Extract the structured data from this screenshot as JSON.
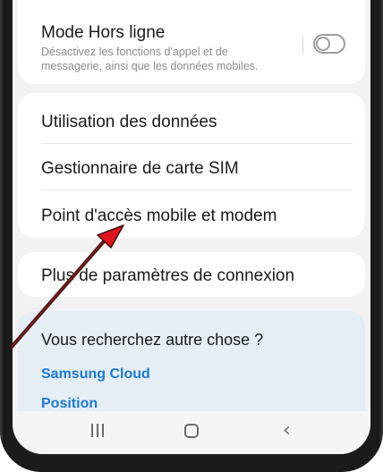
{
  "offline_mode": {
    "title": "Mode Hors ligne",
    "description": "Désactivez les fonctions d'appel et de messagerie, ainsi que les données mobiles.",
    "enabled": false
  },
  "connections": {
    "items": [
      {
        "label": "Utilisation des données"
      },
      {
        "label": "Gestionnaire de carte SIM"
      },
      {
        "label": "Point d'accès mobile et modem"
      }
    ]
  },
  "more_settings": {
    "label": "Plus de paramètres de connexion"
  },
  "suggestions": {
    "title": "Vous recherchez autre chose ?",
    "links": [
      "Samsung Cloud",
      "Position"
    ]
  },
  "navbar": {
    "icons": [
      "recent-apps-icon",
      "home-icon",
      "back-icon"
    ]
  },
  "colors": {
    "accent_link": "#1a7ad1",
    "annotation_arrow": "#e0141e",
    "annotation_arrow_outline": "#3a0d0d"
  }
}
